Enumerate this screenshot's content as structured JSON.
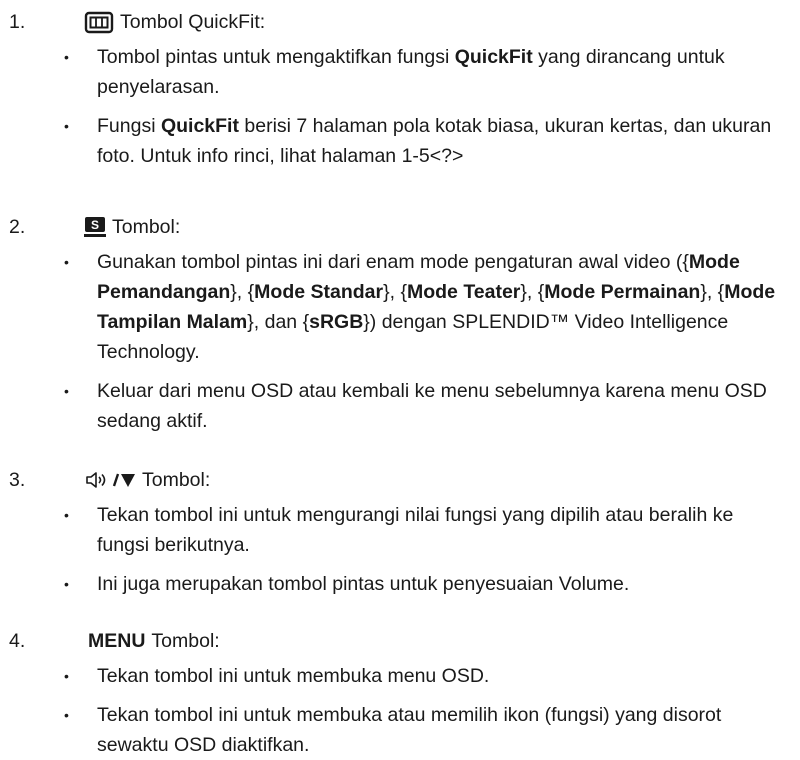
{
  "items": [
    {
      "number": "1.",
      "icon": "quickfit-icon",
      "label": "Tombol QuickFit:",
      "bullets": [
        {
          "parts": [
            {
              "t": "Tombol pintas untuk mengaktifkan fungsi "
            },
            {
              "t": "QuickFit",
              "b": true
            },
            {
              "t": " yang dirancang untuk penyelarasan."
            }
          ]
        },
        {
          "parts": [
            {
              "t": "Fungsi "
            },
            {
              "t": "QuickFit",
              "b": true
            },
            {
              "t": " berisi 7 halaman pola kotak biasa, ukuran kertas, dan ukuran foto. Untuk info rinci, lihat halaman 1-5<?>"
            }
          ]
        }
      ]
    },
    {
      "number": "2.",
      "icon": "splendid-s-icon",
      "icon_text": "S",
      "label": "Tombol:",
      "bullets": [
        {
          "parts": [
            {
              "t": "Gunakan tombol pintas ini dari enam mode pengaturan awal video ({"
            },
            {
              "t": "Mode Pemandangan",
              "b": true
            },
            {
              "t": "}, {"
            },
            {
              "t": "Mode Standar",
              "b": true
            },
            {
              "t": "}, {"
            },
            {
              "t": "Mode Teater",
              "b": true
            },
            {
              "t": "}, {"
            },
            {
              "t": "Mode Permainan",
              "b": true
            },
            {
              "t": "}, {"
            },
            {
              "t": "Mode Tampilan Malam",
              "b": true
            },
            {
              "t": "}, dan {"
            },
            {
              "t": "sRGB",
              "b": true
            },
            {
              "t": "}) dengan SPLENDID™ Video Intelligence Technology."
            }
          ]
        },
        {
          "parts": [
            {
              "t": "Keluar dari menu OSD atau kembali ke menu sebelumnya karena menu OSD sedang aktif."
            }
          ]
        }
      ]
    },
    {
      "number": "3.",
      "icon": "volume-down-icon",
      "label": "Tombol:",
      "bullets": [
        {
          "parts": [
            {
              "t": "Tekan tombol ini untuk mengurangi nilai fungsi yang dipilih atau beralih ke fungsi berikutnya."
            }
          ]
        },
        {
          "parts": [
            {
              "t": "Ini juga merupakan tombol pintas untuk penyesuaian Volume."
            }
          ]
        }
      ]
    },
    {
      "number": "4.",
      "icon_text": "MENU",
      "label": "Tombol:",
      "bullets": [
        {
          "parts": [
            {
              "t": "Tekan tombol ini untuk membuka menu OSD."
            }
          ]
        },
        {
          "parts": [
            {
              "t": "Tekan tombol ini untuk membuka atau memilih ikon (fungsi) yang disorot sewaktu OSD diaktifkan."
            }
          ]
        }
      ]
    }
  ],
  "bullet_char": "•"
}
